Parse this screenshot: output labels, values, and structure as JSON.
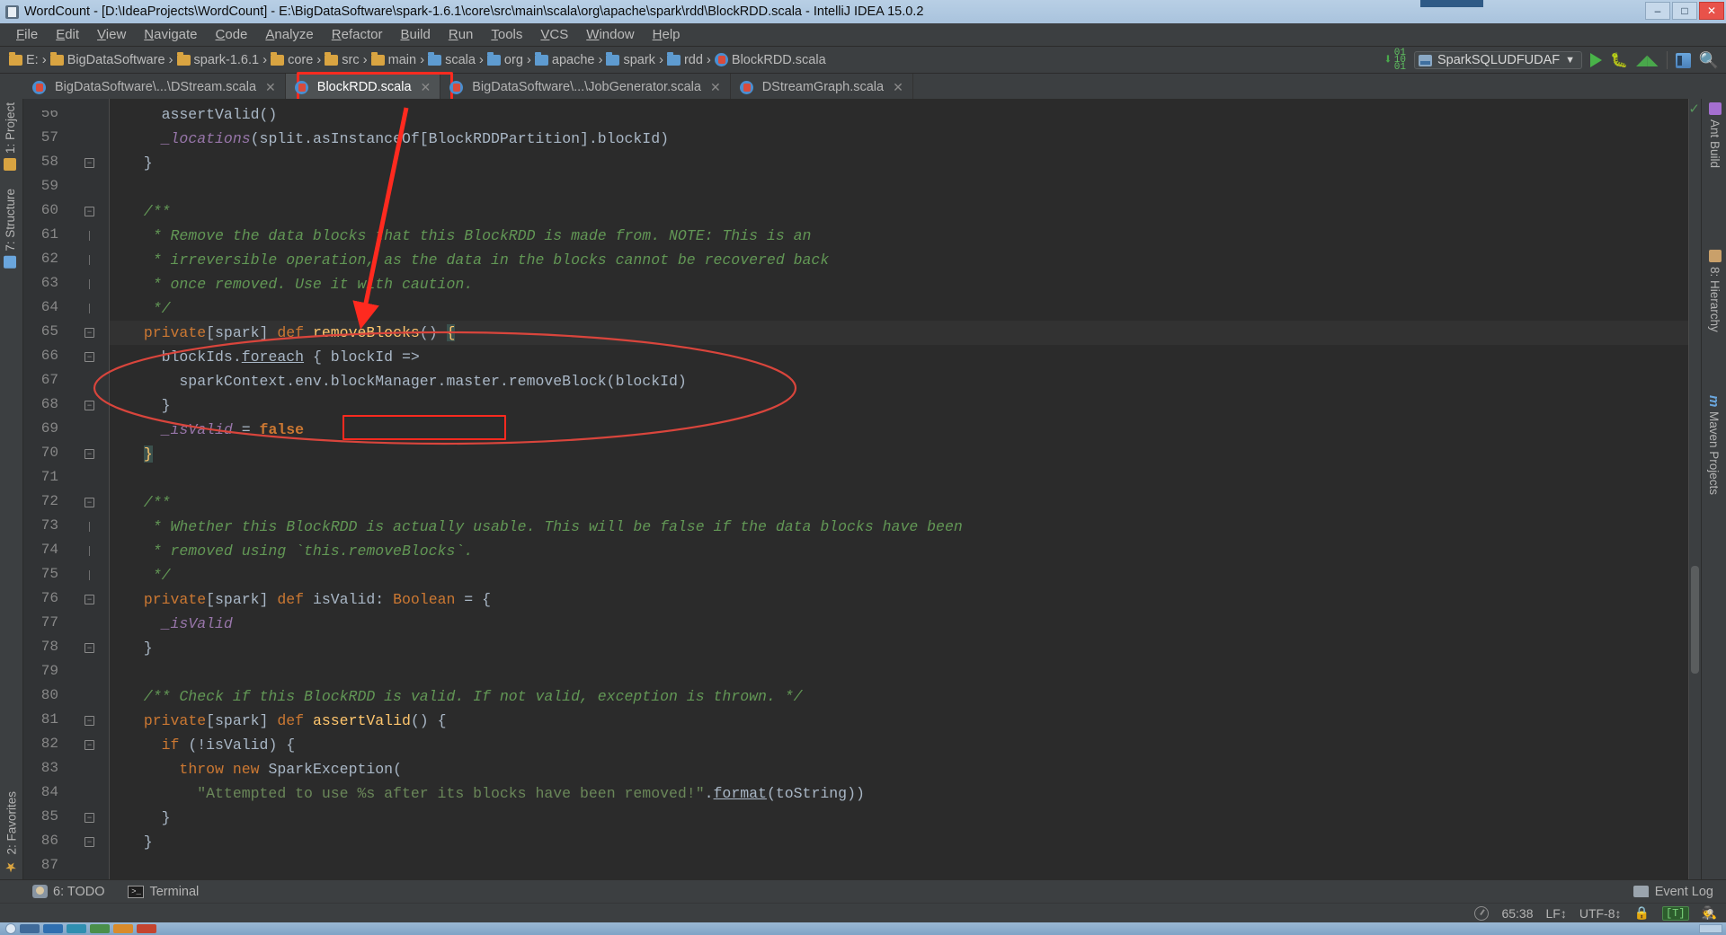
{
  "window": {
    "title": "WordCount - [D:\\IdeaProjects\\WordCount] - E:\\BigDataSoftware\\spark-1.6.1\\core\\src\\main\\scala\\org\\apache\\spark\\rdd\\BlockRDD.scala - IntelliJ IDEA 15.0.2",
    "minimize": "–",
    "maximize": "□",
    "close": "✕"
  },
  "menu": {
    "items": [
      "File",
      "Edit",
      "View",
      "Navigate",
      "Code",
      "Analyze",
      "Refactor",
      "Build",
      "Run",
      "Tools",
      "VCS",
      "Window",
      "Help"
    ]
  },
  "navbar": {
    "crumbs": [
      {
        "label": "E:",
        "icon": "folder-icon"
      },
      {
        "label": "BigDataSoftware",
        "icon": "folder-icon"
      },
      {
        "label": "spark-1.6.1",
        "icon": "folder-icon"
      },
      {
        "label": "core",
        "icon": "folder-icon"
      },
      {
        "label": "src",
        "icon": "folder-icon"
      },
      {
        "label": "main",
        "icon": "folder-icon"
      },
      {
        "label": "scala",
        "icon": "source-folder-icon"
      },
      {
        "label": "org",
        "icon": "source-folder-icon"
      },
      {
        "label": "apache",
        "icon": "source-folder-icon"
      },
      {
        "label": "spark",
        "icon": "source-folder-icon"
      },
      {
        "label": "rdd",
        "icon": "source-folder-icon"
      },
      {
        "label": "BlockRDD.scala",
        "icon": "scala-file-icon"
      }
    ],
    "run_config": "SparkSQLUDFUDAF",
    "dropdown_caret": "▼"
  },
  "tabs": [
    {
      "label": "BigDataSoftware\\...\\DStream.scala",
      "active": false,
      "close": "✕"
    },
    {
      "label": "BlockRDD.scala",
      "active": true,
      "close": "✕"
    },
    {
      "label": "BigDataSoftware\\...\\JobGenerator.scala",
      "active": false,
      "close": "✕"
    },
    {
      "label": "DStreamGraph.scala",
      "active": false,
      "close": "✕"
    }
  ],
  "sidebar_left": [
    {
      "label": "1: Project",
      "icon": "project-icon"
    },
    {
      "label": "7: Structure",
      "icon": "structure-icon"
    },
    {
      "label": "2: Favorites",
      "icon": "star-icon"
    }
  ],
  "sidebar_right": [
    {
      "label": "Ant Build",
      "icon": "ant-icon"
    },
    {
      "label": "8: Hierarchy",
      "icon": "hierarchy-icon"
    },
    {
      "label": "Maven Projects",
      "icon": "maven-icon"
    }
  ],
  "editor": {
    "first_line": 56,
    "lines": [
      {
        "n": 56,
        "fold": "",
        "partial": true,
        "tokens": [
          {
            "t": "    assertValid()",
            "c": "id"
          }
        ]
      },
      {
        "n": 57,
        "fold": "",
        "tokens": [
          {
            "t": "    ",
            "c": "id"
          },
          {
            "t": "_locations",
            "c": "fld"
          },
          {
            "t": "(split.asInstanceOf[BlockRDDPartition].blockId)",
            "c": "id"
          }
        ]
      },
      {
        "n": 58,
        "fold": "minus",
        "tokens": [
          {
            "t": "  }",
            "c": "id"
          }
        ]
      },
      {
        "n": 59,
        "fold": "",
        "tokens": []
      },
      {
        "n": 60,
        "fold": "minus",
        "tokens": [
          {
            "t": "  /**",
            "c": "cm"
          }
        ]
      },
      {
        "n": 61,
        "fold": "line",
        "tokens": [
          {
            "t": "   * Remove the data blocks that this BlockRDD is made from. NOTE: This is an",
            "c": "cm"
          }
        ]
      },
      {
        "n": 62,
        "fold": "line",
        "tokens": [
          {
            "t": "   * irreversible operation, as the data in the blocks cannot be recovered back",
            "c": "cm"
          }
        ]
      },
      {
        "n": 63,
        "fold": "line",
        "tokens": [
          {
            "t": "   * once removed. Use it with caution.",
            "c": "cm"
          }
        ]
      },
      {
        "n": 64,
        "fold": "line",
        "tokens": [
          {
            "t": "   */",
            "c": "cm"
          }
        ]
      },
      {
        "n": 65,
        "fold": "minus",
        "highlight": true,
        "tokens": [
          {
            "t": "  ",
            "c": "id"
          },
          {
            "t": "private",
            "c": "k"
          },
          {
            "t": "[spark] ",
            "c": "id"
          },
          {
            "t": "def",
            "c": "k"
          },
          {
            "t": " ",
            "c": "id"
          },
          {
            "t": "removeBlocks",
            "c": "fn"
          },
          {
            "t": "() ",
            "c": "id"
          },
          {
            "t": "{",
            "c": "brace-hl"
          }
        ]
      },
      {
        "n": 66,
        "fold": "minus",
        "tokens": [
          {
            "t": "    blockIds.",
            "c": "id"
          },
          {
            "t": "foreach",
            "c": "id u"
          },
          {
            "t": " { blockId =>",
            "c": "id"
          }
        ]
      },
      {
        "n": 67,
        "fold": "",
        "tokens": [
          {
            "t": "      sparkContext.env.blockManager.master.removeBlock(blockId)",
            "c": "id"
          }
        ]
      },
      {
        "n": 68,
        "fold": "minus",
        "tokens": [
          {
            "t": "    }",
            "c": "id"
          }
        ]
      },
      {
        "n": 69,
        "fold": "",
        "tokens": [
          {
            "t": "    ",
            "c": "id"
          },
          {
            "t": "_isValid",
            "c": "fld"
          },
          {
            "t": " = ",
            "c": "id"
          },
          {
            "t": "false",
            "c": "kb"
          }
        ]
      },
      {
        "n": 70,
        "fold": "minus",
        "tokens": [
          {
            "t": "  ",
            "c": "id"
          },
          {
            "t": "}",
            "c": "brace-hl"
          }
        ]
      },
      {
        "n": 71,
        "fold": "",
        "tokens": []
      },
      {
        "n": 72,
        "fold": "minus",
        "tokens": [
          {
            "t": "  /**",
            "c": "cm"
          }
        ]
      },
      {
        "n": 73,
        "fold": "line",
        "tokens": [
          {
            "t": "   * Whether this BlockRDD is actually usable. This will be false if the data blocks have been",
            "c": "cm"
          }
        ]
      },
      {
        "n": 74,
        "fold": "line",
        "tokens": [
          {
            "t": "   * removed using `this.removeBlocks`.",
            "c": "cm"
          }
        ]
      },
      {
        "n": 75,
        "fold": "line",
        "tokens": [
          {
            "t": "   */",
            "c": "cm"
          }
        ]
      },
      {
        "n": 76,
        "fold": "minus",
        "tokens": [
          {
            "t": "  ",
            "c": "id"
          },
          {
            "t": "private",
            "c": "k"
          },
          {
            "t": "[spark] ",
            "c": "id"
          },
          {
            "t": "def",
            "c": "k"
          },
          {
            "t": " isValid: ",
            "c": "id"
          },
          {
            "t": "Boolean",
            "c": "k"
          },
          {
            "t": " = {",
            "c": "id"
          }
        ]
      },
      {
        "n": 77,
        "fold": "",
        "tokens": [
          {
            "t": "    ",
            "c": "id"
          },
          {
            "t": "_isValid",
            "c": "fld"
          }
        ]
      },
      {
        "n": 78,
        "fold": "minus",
        "tokens": [
          {
            "t": "  }",
            "c": "id"
          }
        ]
      },
      {
        "n": 79,
        "fold": "",
        "tokens": []
      },
      {
        "n": 80,
        "fold": "",
        "tokens": [
          {
            "t": "  /** Check if this BlockRDD is valid. If not valid, exception is thrown. */",
            "c": "cm"
          }
        ]
      },
      {
        "n": 81,
        "fold": "minus",
        "tokens": [
          {
            "t": "  ",
            "c": "id"
          },
          {
            "t": "private",
            "c": "k"
          },
          {
            "t": "[spark] ",
            "c": "id"
          },
          {
            "t": "def",
            "c": "k"
          },
          {
            "t": " ",
            "c": "id"
          },
          {
            "t": "assertValid",
            "c": "fn"
          },
          {
            "t": "() {",
            "c": "id"
          }
        ]
      },
      {
        "n": 82,
        "fold": "minus",
        "tokens": [
          {
            "t": "    ",
            "c": "id"
          },
          {
            "t": "if",
            "c": "k"
          },
          {
            "t": " (!isValid) {",
            "c": "id"
          }
        ]
      },
      {
        "n": 83,
        "fold": "",
        "tokens": [
          {
            "t": "      ",
            "c": "id"
          },
          {
            "t": "throw new",
            "c": "k"
          },
          {
            "t": " SparkException(",
            "c": "id"
          }
        ]
      },
      {
        "n": 84,
        "fold": "",
        "tokens": [
          {
            "t": "        ",
            "c": "id"
          },
          {
            "t": "\"Attempted to use %s after its blocks have been removed!\"",
            "c": "str"
          },
          {
            "t": ".",
            "c": "id"
          },
          {
            "t": "format",
            "c": "id u"
          },
          {
            "t": "(toString))",
            "c": "id"
          }
        ]
      },
      {
        "n": 85,
        "fold": "minus",
        "tokens": [
          {
            "t": "    }",
            "c": "id"
          }
        ]
      },
      {
        "n": 86,
        "fold": "minus",
        "tokens": [
          {
            "t": "  }",
            "c": "id"
          }
        ]
      },
      {
        "n": 87,
        "fold": "",
        "tokens": []
      }
    ]
  },
  "bottom_toolbar": {
    "todo": "6: TODO",
    "terminal": "Terminal",
    "event_log": "Event Log"
  },
  "statusbar": {
    "caret_position": "65:38",
    "line_separator": "LF↕",
    "encoding": "UTF-8↕",
    "lock_icon": "ὑ2",
    "type_badge": "[T]",
    "hat_icon": "hat-icon"
  },
  "annotations": {
    "tab_highlight": "red-rectangle-around-blockrdd-tab",
    "method_highlight": "red-rectangle-around-removeBlocks",
    "arrow": "red-arrow-from-tab-to-method",
    "ellipse": "red-ellipse-around-method-body"
  },
  "colors": {
    "accent_red": "#ff2a1f",
    "editor_bg": "#2b2b2b",
    "chrome_bg": "#3c3f41",
    "comment_green": "#629755",
    "keyword_orange": "#cc7832",
    "function_yellow": "#ffc66d",
    "field_purple": "#9876aa",
    "string_green": "#6a8759"
  }
}
